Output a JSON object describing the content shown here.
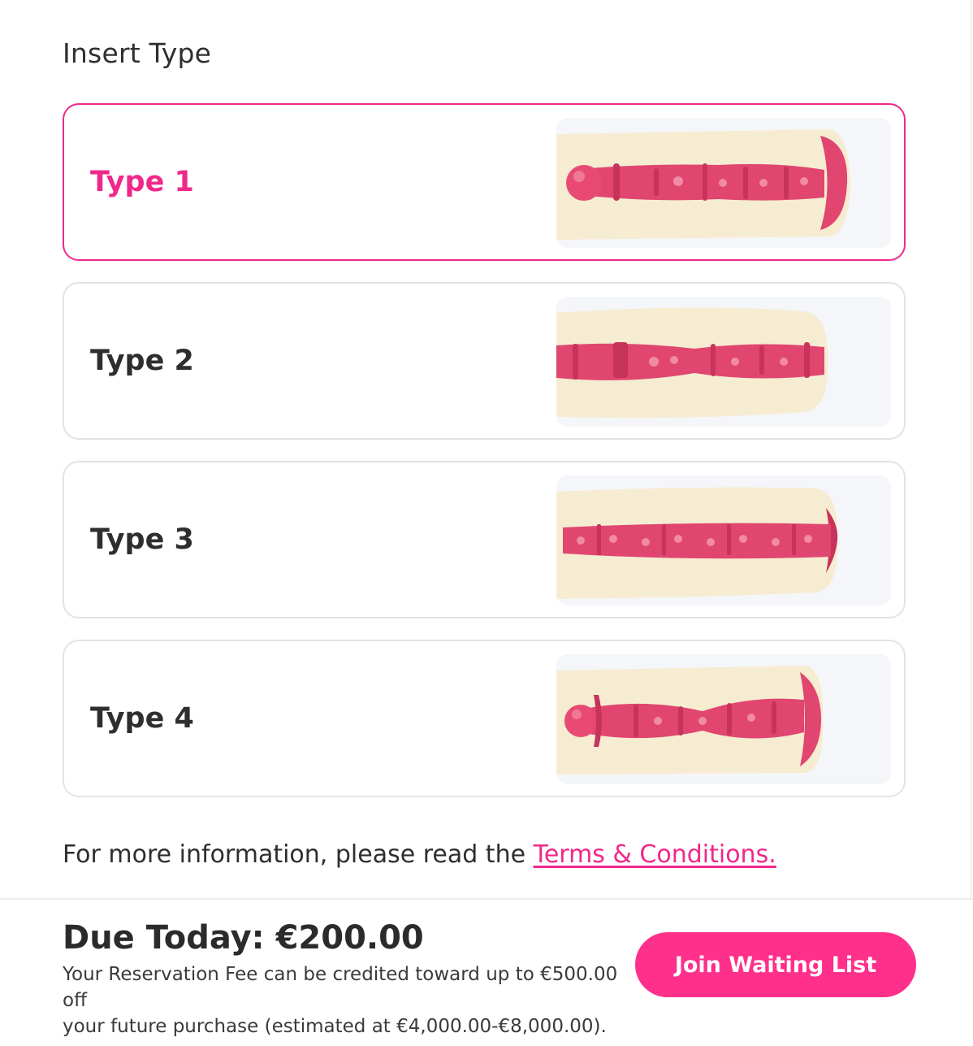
{
  "section": {
    "title": "Insert Type"
  },
  "options": [
    {
      "label": "Type 1",
      "selected": true,
      "image": "insert-type-1-image"
    },
    {
      "label": "Type 2",
      "selected": false,
      "image": "insert-type-2-image"
    },
    {
      "label": "Type 3",
      "selected": false,
      "image": "insert-type-3-image"
    },
    {
      "label": "Type 4",
      "selected": false,
      "image": "insert-type-4-image"
    }
  ],
  "info": {
    "text": "For more information, please read the ",
    "link_label": "Terms & Conditions."
  },
  "footer": {
    "due_today": "Due Today: €200.00",
    "note_line1": "Your Reservation Fee can be credited toward up to €500.00 off",
    "note_line2": "your future purchase (estimated at €4,000.00-€8,000.00).",
    "cta_label": "Join Waiting List"
  },
  "colors": {
    "accent": "#f0288a",
    "button": "#ff2f8c",
    "card_border": "#e3e3e3",
    "insert_body": "#f6ecd2",
    "insert_channel": "#e0466f"
  }
}
